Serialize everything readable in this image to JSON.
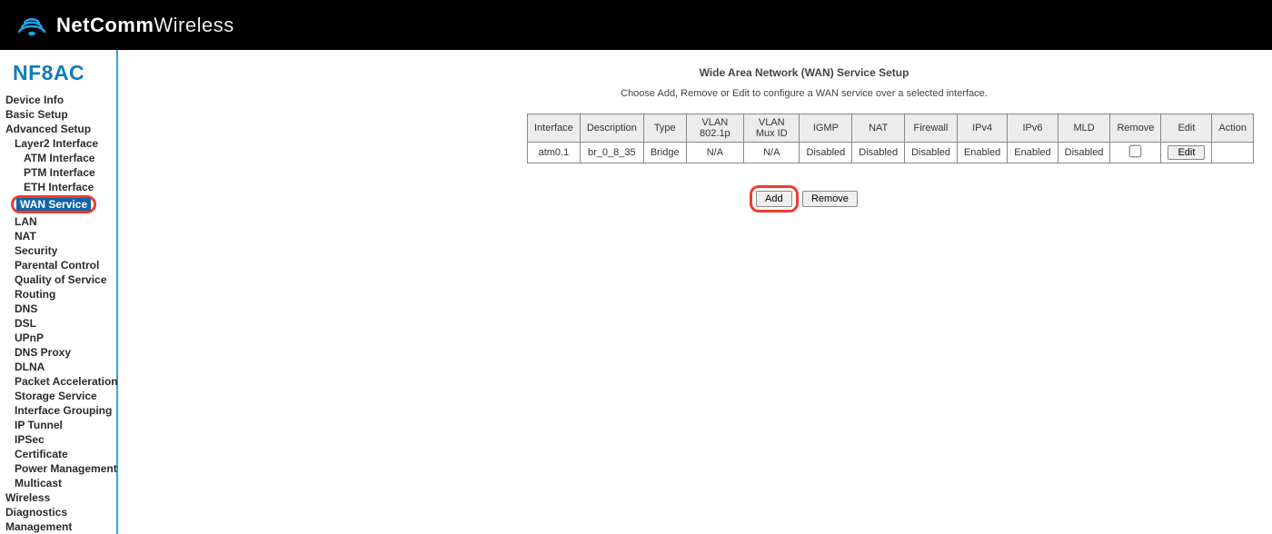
{
  "brand": {
    "name_bold": "NetComm",
    "name_light": "Wireless"
  },
  "model": "NF8AC",
  "nav": {
    "device_info": "Device Info",
    "basic_setup": "Basic Setup",
    "advanced_setup": "Advanced Setup",
    "layer2_interface": "Layer2 Interface",
    "atm_interface": "ATM Interface",
    "ptm_interface": "PTM Interface",
    "eth_interface": "ETH Interface",
    "wan_service": "WAN Service",
    "lan": "LAN",
    "nat": "NAT",
    "security": "Security",
    "parental_control": "Parental Control",
    "qos": "Quality of Service",
    "routing": "Routing",
    "dns": "DNS",
    "dsl": "DSL",
    "upnp": "UPnP",
    "dns_proxy": "DNS Proxy",
    "dlna": "DLNA",
    "packet_accel": "Packet Acceleration",
    "storage_service": "Storage Service",
    "interface_grouping": "Interface Grouping",
    "ip_tunnel": "IP Tunnel",
    "ipsec": "IPSec",
    "certificate": "Certificate",
    "power_mgmt": "Power Management",
    "multicast": "Multicast",
    "wireless": "Wireless",
    "diagnostics": "Diagnostics",
    "management": "Management"
  },
  "page": {
    "title": "Wide Area Network (WAN) Service Setup",
    "subtitle": "Choose Add, Remove or Edit to configure a WAN service over a selected interface."
  },
  "table": {
    "headers": {
      "interface": "Interface",
      "description": "Description",
      "type": "Type",
      "vlan8021p": "VLAN 802.1p",
      "vlanmux": "VLAN Mux ID",
      "igmp": "IGMP",
      "nat": "NAT",
      "firewall": "Firewall",
      "ipv4": "IPv4",
      "ipv6": "IPv6",
      "mld": "MLD",
      "remove": "Remove",
      "edit": "Edit",
      "action": "Action"
    },
    "row0": {
      "interface": "atm0.1",
      "description": "br_0_8_35",
      "type": "Bridge",
      "vlan8021p": "N/A",
      "vlanmux": "N/A",
      "igmp": "Disabled",
      "nat": "Disabled",
      "firewall": "Disabled",
      "ipv4": "Enabled",
      "ipv6": "Enabled",
      "mld": "Disabled",
      "edit_label": "Edit"
    }
  },
  "buttons": {
    "add": "Add",
    "remove": "Remove"
  }
}
